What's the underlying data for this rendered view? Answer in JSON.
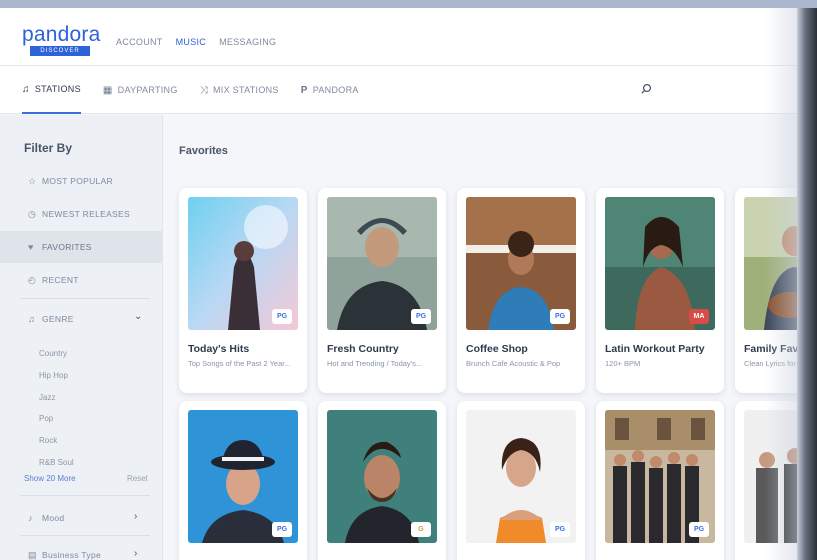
{
  "app": {
    "logo": "pandora",
    "logo_sub": "DISCOVER",
    "top_nav": [
      "ACCOUNT",
      "MUSIC",
      "MESSAGING"
    ],
    "active_top_nav": "MUSIC"
  },
  "tabs": [
    {
      "label": "STATIONS",
      "icon": "music-note-icon",
      "active": true
    },
    {
      "label": "DAYPARTING",
      "icon": "calendar-icon",
      "active": false
    },
    {
      "label": "MIX STATIONS",
      "icon": "shuffle-icon",
      "active": false
    },
    {
      "label": "PANDORA",
      "icon": "pandora-p-icon",
      "active": false
    }
  ],
  "search": {
    "icon": "search-icon"
  },
  "sidebar": {
    "title": "Filter By",
    "filters": [
      {
        "label": "MOST POPULAR",
        "icon": "star-icon"
      },
      {
        "label": "NEWEST RELEASES",
        "icon": "clock-icon"
      },
      {
        "label": "FAVORITES",
        "icon": "heart-icon"
      },
      {
        "label": "RECENT",
        "icon": "history-icon"
      }
    ],
    "active_filter": "FAVORITES",
    "genre": {
      "label": "GENRE",
      "icon": "music-note-icon"
    },
    "genres": [
      "Country",
      "Hip Hop",
      "Jazz",
      "Pop",
      "Rock",
      "R&B Soul"
    ],
    "show_more": "Show 20 More",
    "reset": "Reset",
    "mood": {
      "label": "Mood",
      "icon": "mood-icon"
    },
    "business_type": {
      "label": "Business Type",
      "icon": "building-icon"
    }
  },
  "main": {
    "section_title": "Favorites",
    "row1": [
      {
        "title": "Today's Hits",
        "subtitle": "Top Songs of the Past 2 Year...",
        "rating": "PG"
      },
      {
        "title": "Fresh Country",
        "subtitle": "Hot and Trending / Today's...",
        "rating": "PG"
      },
      {
        "title": "Coffee Shop",
        "subtitle": "Brunch Cafe Acoustic & Pop",
        "rating": "PG"
      },
      {
        "title": "Latin Workout Party",
        "subtitle": "120+ BPM",
        "rating": "MA"
      },
      {
        "title": "Family Favorites",
        "subtitle": "Clean Lyrics for All",
        "rating": ""
      }
    ],
    "row2": [
      {
        "rating": "PG"
      },
      {
        "rating": "G"
      },
      {
        "rating": "PG"
      },
      {
        "rating": "PG"
      },
      {
        "rating": ""
      }
    ]
  },
  "colors": {
    "accent": "#2d62d8",
    "explicit_badge": "#d94b47",
    "sidebar_bg": "#edf0f4"
  }
}
